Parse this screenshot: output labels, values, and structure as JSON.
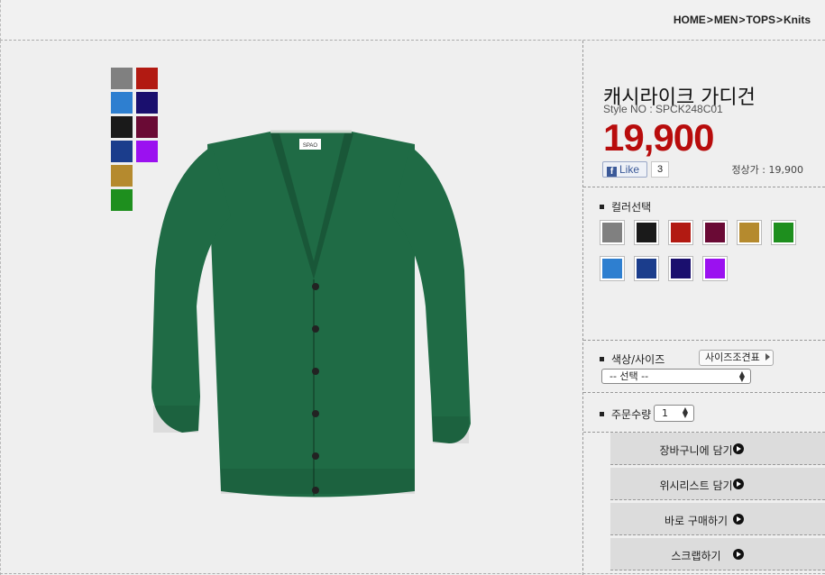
{
  "breadcrumb": [
    "HOME",
    "MEN",
    "TOPS",
    "Knits"
  ],
  "breadcrumb_sep": ">",
  "thumb_colors": [
    "#808080",
    "#b21a12",
    "#2e7fd0",
    "#1a0f6e",
    "#1a1a1a",
    "#6a0a35",
    "#1b3d8c",
    "#9b11f0",
    "#b58a2e",
    "#1e8f1e"
  ],
  "product": {
    "name": "캐시라이크 가디건",
    "style_no": "Style NO : SPCK248C01",
    "price": "19,900",
    "original_price": "정상가 : 19,900",
    "like_label": "Like",
    "like_count": "3",
    "image_color": "#1f6b45"
  },
  "color_section": {
    "label": "컬러선택",
    "swatches": [
      "#808080",
      "#1a1a1a",
      "#b21a12",
      "#6a0a35",
      "#b58a2e",
      "#1e8f1e",
      "#2e7fd0",
      "#1b3d8c",
      "#1a0f6e",
      "#9b11f0"
    ]
  },
  "size_section": {
    "label": "색상/사이즈",
    "size_guide": "사이즈조견표",
    "select_value": "-- 선택 --"
  },
  "qty_section": {
    "label": "주문수량",
    "value": "1"
  },
  "actions": [
    "장바구니에 담기",
    "위시리스트 담기",
    "바로 구매하기",
    "스크랩하기"
  ]
}
